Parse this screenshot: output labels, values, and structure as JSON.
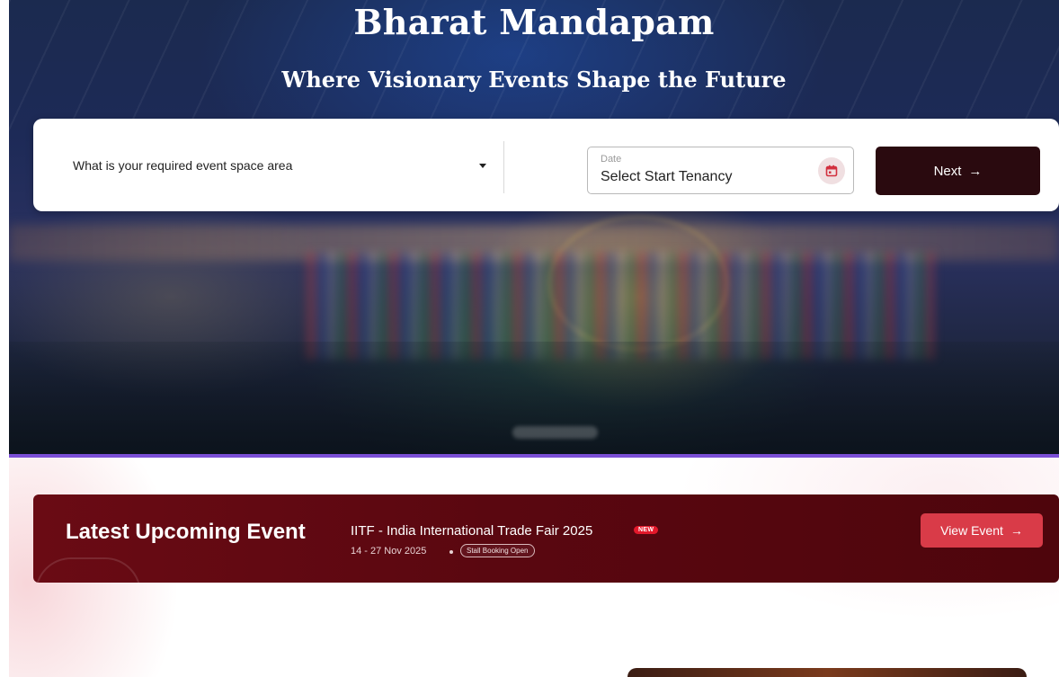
{
  "hero": {
    "title": "Bharat Mandapam",
    "subtitle": "Where Visionary Events Shape the Future"
  },
  "search": {
    "area_select_label": "What is your required event space area",
    "date_label": "Date",
    "date_value": "Select Start Tenancy",
    "calendar_icon": "calendar-icon",
    "next_label": "Next",
    "next_icon": "arrow-right-icon"
  },
  "upcoming_event": {
    "section_title": "Latest Upcoming Event",
    "event_name": "IITF - India International Trade Fair 2025",
    "badge": "NEW",
    "dates": "14 - 27 Nov 2025",
    "status": "Stall Booking Open",
    "button_label": "View Event",
    "button_icon": "arrow-right-icon"
  },
  "colors": {
    "hero_underline": "#7b4fd6",
    "next_button": "#2a0a0f",
    "banner": "#5a0710",
    "view_event_button": "#d93b48",
    "new_badge": "#e3192b"
  }
}
